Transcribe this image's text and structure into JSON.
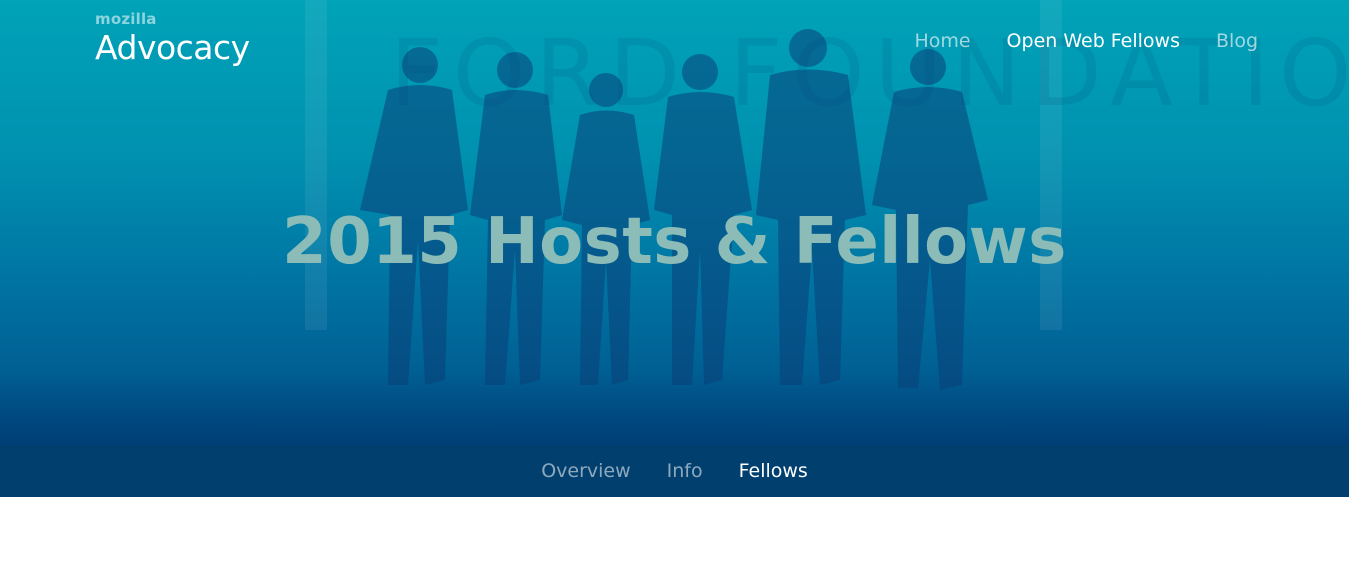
{
  "brand": {
    "small": "mozilla",
    "name": "Advocacy"
  },
  "top_nav": {
    "items": [
      {
        "label": "Home",
        "active": false
      },
      {
        "label": "Open Web Fellows",
        "active": true
      },
      {
        "label": "Blog",
        "active": false
      }
    ]
  },
  "hero": {
    "title": "2015 Hosts & Fellows",
    "background_sign": "FORD FOUNDATION"
  },
  "sub_nav": {
    "items": [
      {
        "label": "Overview",
        "active": false
      },
      {
        "label": "Info",
        "active": false
      },
      {
        "label": "Fellows",
        "active": true
      }
    ]
  },
  "colors": {
    "hero_top": "#00a3b8",
    "hero_bottom": "#004f86",
    "subnav_bg": "#003f6e",
    "title": "#8cbcb8"
  }
}
